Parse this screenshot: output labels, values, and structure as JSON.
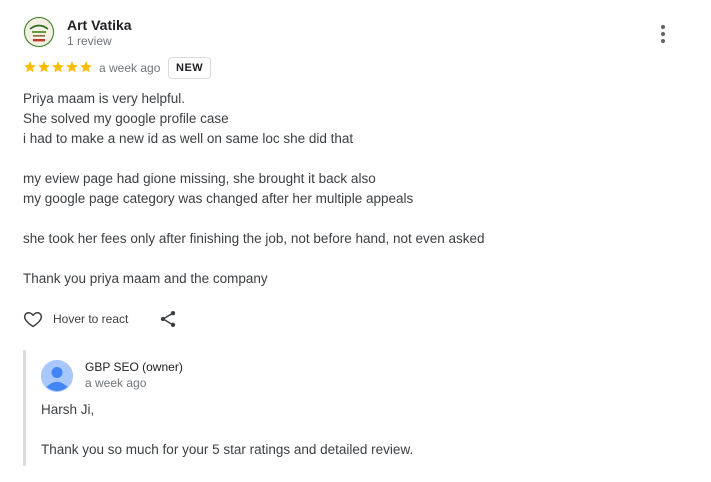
{
  "review": {
    "reviewer_name": "Art Vatika",
    "reviewer_meta": "1 review",
    "avatar_icon": "business-logo-icon",
    "rating": 5,
    "rating_max": 5,
    "star_color": "#fbbc04",
    "time_ago": "a week ago",
    "badge": "NEW",
    "lines": [
      "Priya maam is very helpful.",
      "She solved my google profile case",
      "i had to make a new id as well on same loc she did that",
      "",
      "my eview page had gione missing, she brought it back also",
      "my google page category was changed after her multiple appeals",
      "",
      "she took her fees only after finishing the job, not before hand, not even asked",
      "",
      "Thank you priya maam and the company"
    ],
    "react_label": "Hover to react",
    "react_icon": "heart-outline-icon",
    "share_icon": "share-icon",
    "more_icon": "more-vertical-icon"
  },
  "reply": {
    "owner_name": "GBP SEO (owner)",
    "owner_avatar_icon": "person-avatar-icon",
    "owner_avatar_color": "#a8c7fa",
    "time_ago": "a week ago",
    "lines": [
      "Harsh Ji,",
      "",
      "Thank you so much for your 5 star ratings and detailed review."
    ]
  }
}
